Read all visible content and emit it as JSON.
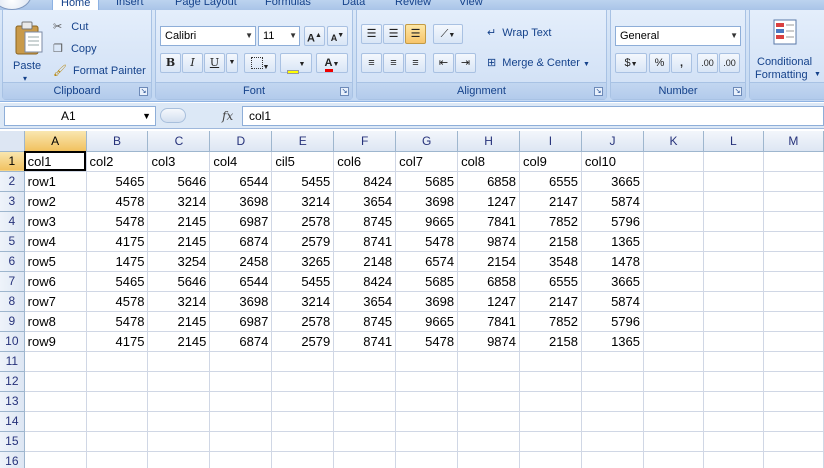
{
  "tabs": [
    {
      "label": "Home",
      "active": true
    },
    {
      "label": "Insert"
    },
    {
      "label": "Page Layout"
    },
    {
      "label": "Formulas"
    },
    {
      "label": "Data"
    },
    {
      "label": "Review"
    },
    {
      "label": "View"
    }
  ],
  "clipboard": {
    "paste": "Paste",
    "cut": "Cut",
    "copy": "Copy",
    "format_painter": "Format Painter",
    "label": "Clipboard"
  },
  "font": {
    "name": "Calibri",
    "size": "11",
    "grow": "A",
    "shrink": "A",
    "bold": "B",
    "italic": "I",
    "underline": "U",
    "font_color_letter": "A",
    "label": "Font"
  },
  "alignment": {
    "wrap_text": "Wrap Text",
    "merge_center": "Merge & Center",
    "label": "Alignment"
  },
  "number": {
    "format": "General",
    "currency": "$",
    "percent": "%",
    "comma": ",",
    "inc_decimal": ".00",
    "dec_decimal": ".00",
    "label": "Number"
  },
  "styles": {
    "conditional_line1": "Conditional",
    "conditional_line2": "Formatting"
  },
  "formula_bar": {
    "name_box": "A1",
    "fx": "fx",
    "content": "col1"
  },
  "sheet": {
    "columns": [
      "A",
      "B",
      "C",
      "D",
      "E",
      "F",
      "G",
      "H",
      "I",
      "J",
      "K",
      "L",
      "M"
    ],
    "active_cell": "A1",
    "rows": [
      {
        "num": "1",
        "cells": [
          "col1",
          "col2",
          "col3",
          "col4",
          "cil5",
          "col6",
          "col7",
          "col8",
          "col9",
          "col10",
          "",
          "",
          ""
        ]
      },
      {
        "num": "2",
        "cells": [
          "row1",
          "5465",
          "5646",
          "6544",
          "5455",
          "8424",
          "5685",
          "6858",
          "6555",
          "3665",
          "",
          "",
          ""
        ]
      },
      {
        "num": "3",
        "cells": [
          "row2",
          "4578",
          "3214",
          "3698",
          "3214",
          "3654",
          "3698",
          "1247",
          "2147",
          "5874",
          "",
          "",
          ""
        ]
      },
      {
        "num": "4",
        "cells": [
          "row3",
          "5478",
          "2145",
          "6987",
          "2578",
          "8745",
          "9665",
          "7841",
          "7852",
          "5796",
          "",
          "",
          ""
        ]
      },
      {
        "num": "5",
        "cells": [
          "row4",
          "4175",
          "2145",
          "6874",
          "2579",
          "8741",
          "5478",
          "9874",
          "2158",
          "1365",
          "",
          "",
          ""
        ]
      },
      {
        "num": "6",
        "cells": [
          "row5",
          "1475",
          "3254",
          "2458",
          "3265",
          "2148",
          "6574",
          "2154",
          "3548",
          "1478",
          "",
          "",
          ""
        ]
      },
      {
        "num": "7",
        "cells": [
          "row6",
          "5465",
          "5646",
          "6544",
          "5455",
          "8424",
          "5685",
          "6858",
          "6555",
          "3665",
          "",
          "",
          ""
        ]
      },
      {
        "num": "8",
        "cells": [
          "row7",
          "4578",
          "3214",
          "3698",
          "3214",
          "3654",
          "3698",
          "1247",
          "2147",
          "5874",
          "",
          "",
          ""
        ]
      },
      {
        "num": "9",
        "cells": [
          "row8",
          "5478",
          "2145",
          "6987",
          "2578",
          "8745",
          "9665",
          "7841",
          "7852",
          "5796",
          "",
          "",
          ""
        ]
      },
      {
        "num": "10",
        "cells": [
          "row9",
          "4175",
          "2145",
          "6874",
          "2579",
          "8741",
          "5478",
          "9874",
          "2158",
          "1365",
          "",
          "",
          ""
        ]
      },
      {
        "num": "11",
        "cells": [
          "",
          "",
          "",
          "",
          "",
          "",
          "",
          "",
          "",
          "",
          "",
          "",
          ""
        ]
      },
      {
        "num": "12",
        "cells": [
          "",
          "",
          "",
          "",
          "",
          "",
          "",
          "",
          "",
          "",
          "",
          "",
          ""
        ]
      },
      {
        "num": "13",
        "cells": [
          "",
          "",
          "",
          "",
          "",
          "",
          "",
          "",
          "",
          "",
          "",
          "",
          ""
        ]
      },
      {
        "num": "14",
        "cells": [
          "",
          "",
          "",
          "",
          "",
          "",
          "",
          "",
          "",
          "",
          "",
          "",
          ""
        ]
      },
      {
        "num": "15",
        "cells": [
          "",
          "",
          "",
          "",
          "",
          "",
          "",
          "",
          "",
          "",
          "",
          "",
          ""
        ]
      },
      {
        "num": "16",
        "cells": [
          "",
          "",
          "",
          "",
          "",
          "",
          "",
          "",
          "",
          "",
          "",
          "",
          ""
        ]
      }
    ]
  },
  "colors": {
    "ribbon": "#c9dcf3",
    "tab_text": "#15428b",
    "grid_line": "#d0d7e5",
    "selected_header": "#f1c15f"
  }
}
